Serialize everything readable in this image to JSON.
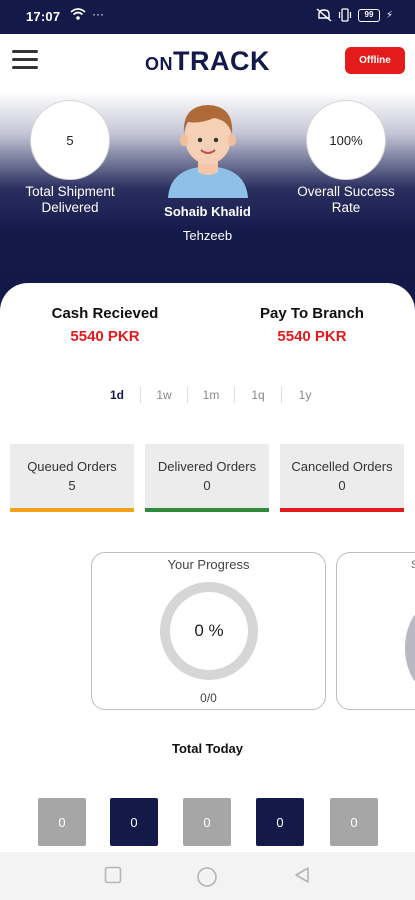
{
  "statusbar": {
    "time": "17:07",
    "battery": "99"
  },
  "header": {
    "logo_small": "ON",
    "logo_big": "TRACK",
    "status_button": "Offline"
  },
  "stats": {
    "total_shipments": {
      "value": "5",
      "label": "Total Shipment Delivered"
    },
    "success_rate": {
      "value": "100%",
      "label": "Overall Success Rate"
    }
  },
  "user": {
    "name": "Sohaib Khalid",
    "role": "Tehzeeb"
  },
  "cash": {
    "received": {
      "label": "Cash Recieved",
      "value": "5540 PKR"
    },
    "pay_to_branch": {
      "label": "Pay To Branch",
      "value": "5540 PKR"
    }
  },
  "period_tabs": [
    "1d",
    "1w",
    "1m",
    "1q",
    "1y"
  ],
  "selected_period": "1d",
  "orders": [
    {
      "label": "Queued Orders",
      "value": "5",
      "color": "#f5a21a"
    },
    {
      "label": "Delivered Orders",
      "value": "0",
      "color": "#2e8b3a"
    },
    {
      "label": "Cancelled Orders",
      "value": "0",
      "color": "#e31b1b"
    }
  ],
  "progress": {
    "title": "Your Progress",
    "percent_text": "0 %",
    "count_text": "0/0"
  },
  "peek_card": {
    "title_fragment": "S"
  },
  "total_today": {
    "label": "Total Today",
    "values": [
      "0",
      "0",
      "0",
      "0",
      "0"
    ]
  },
  "colors": {
    "brand_navy": "#131a4a",
    "accent_red": "#e31b1b"
  }
}
